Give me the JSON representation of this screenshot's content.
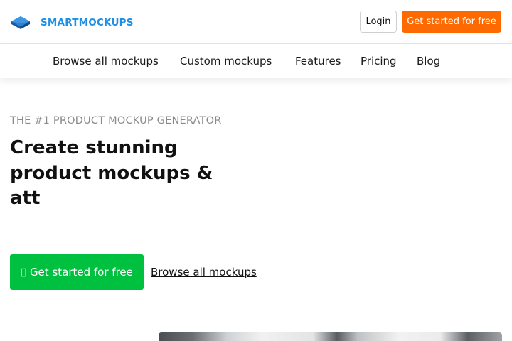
{
  "header": {
    "logo_text": "SMARTMOCKUPS",
    "logo_icon": "stacked-layers-icon",
    "login_label": "Login",
    "cta_label": "Get started for free"
  },
  "nav": {
    "items": [
      {
        "label": "Browse all mockups"
      },
      {
        "label": "Custom mockups"
      },
      {
        "label": "Features"
      },
      {
        "label": "Pricing"
      },
      {
        "label": "Blog"
      }
    ]
  },
  "hero": {
    "eyebrow": "THE #1 PRODUCT MOCKUP GENERATOR",
    "headline": "Create stunning product mockups & att",
    "cta_icon": "",
    "cta_label": "Get started for free",
    "secondary_link": "Browse all mockups"
  },
  "colors": {
    "brand_blue": "#1d8fe6",
    "orange_cta": "#ff6a00",
    "green_cta": "#00c13f"
  }
}
